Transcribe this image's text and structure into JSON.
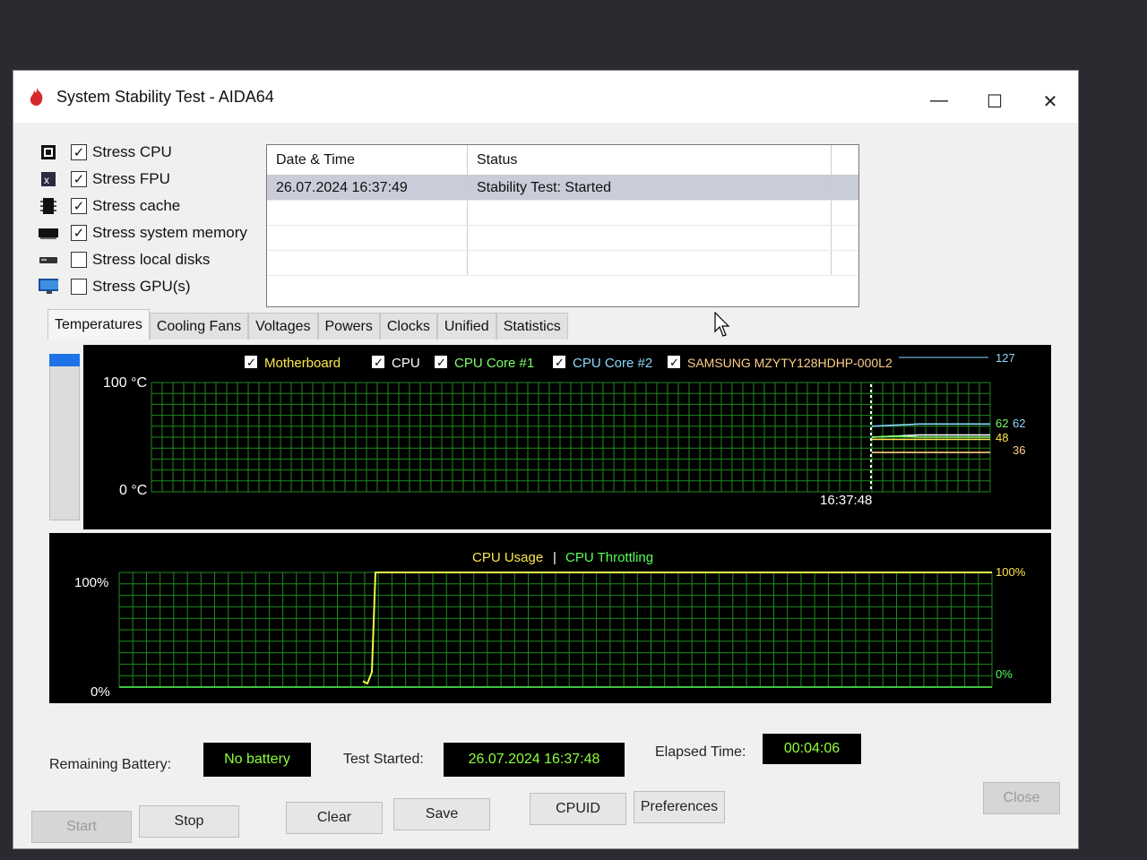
{
  "window": {
    "title": "System Stability Test - AIDA64",
    "controls": {
      "minimize": "—",
      "maximize": "☐",
      "close": "✕"
    }
  },
  "stress_options": [
    {
      "label": "Stress CPU",
      "checked": true,
      "icon": "cpu-chip-icon"
    },
    {
      "label": "Stress FPU",
      "checked": true,
      "icon": "fpu-chip-icon"
    },
    {
      "label": "Stress cache",
      "checked": true,
      "icon": "cache-chip-icon"
    },
    {
      "label": "Stress system memory",
      "checked": true,
      "icon": "memory-module-icon"
    },
    {
      "label": "Stress local disks",
      "checked": false,
      "icon": "disk-drive-icon"
    },
    {
      "label": "Stress GPU(s)",
      "checked": false,
      "icon": "monitor-icon"
    }
  ],
  "status_table": {
    "headers": [
      "Date & Time",
      "Status"
    ],
    "rows": [
      {
        "datetime": "26.07.2024 16:37:49",
        "status": "Stability Test: Started"
      }
    ]
  },
  "tabs": [
    "Temperatures",
    "Cooling Fans",
    "Voltages",
    "Powers",
    "Clocks",
    "Unified",
    "Statistics"
  ],
  "active_tab": "Temperatures",
  "temperature_chart": {
    "legend": [
      {
        "label": "Motherboard",
        "checked": true,
        "color": "#ffe74d"
      },
      {
        "label": "CPU",
        "checked": true,
        "color": "#ffffff"
      },
      {
        "label": "CPU Core #1",
        "checked": true,
        "color": "#7dff6a"
      },
      {
        "label": "CPU Core #2",
        "checked": true,
        "color": "#8cd7ff"
      },
      {
        "label": "SAMSUNG MZYTY128HDHP-000L2",
        "checked": true,
        "color": "#ffcf8a"
      }
    ],
    "y_top_label": "100 °C",
    "y_bottom_label": "0 °C",
    "time_label": "16:37:48",
    "right_values": [
      "127",
      "62",
      "62",
      "48",
      "36"
    ]
  },
  "cpu_chart": {
    "title_usage": "CPU Usage",
    "separator": "|",
    "title_throttling": "CPU Throttling",
    "y_top_label": "100%",
    "y_bottom_label": "0%",
    "right_top": "100%",
    "right_bottom": "0%"
  },
  "chart_data": [
    {
      "type": "line",
      "title": "",
      "ylim": [
        0,
        100
      ],
      "series": [
        {
          "name": "CPU Core #2",
          "values": [
            60,
            61,
            62,
            62,
            62,
            62
          ]
        },
        {
          "name": "CPU",
          "values": [
            50,
            51,
            52,
            52,
            52,
            52
          ]
        },
        {
          "name": "CPU Core #1",
          "values": [
            50,
            51,
            50,
            50,
            50,
            50
          ]
        },
        {
          "name": "Motherboard",
          "values": [
            48,
            48,
            48,
            48,
            48,
            48
          ]
        },
        {
          "name": "SAMSUNG MZYTY128HDHP-000L2",
          "values": [
            36,
            36,
            36,
            36,
            36,
            36
          ]
        }
      ]
    },
    {
      "type": "line",
      "title": "CPU Usage | CPU Throttling",
      "ylim": [
        0,
        100
      ],
      "series": [
        {
          "name": "CPU Usage",
          "values": [
            2,
            0,
            10,
            100,
            100,
            100,
            100,
            100,
            100,
            100,
            100,
            100
          ]
        },
        {
          "name": "CPU Throttling",
          "values": [
            0,
            0,
            0,
            0,
            0,
            0,
            0,
            0,
            0,
            0,
            0,
            0
          ]
        }
      ]
    }
  ],
  "info": {
    "battery_label": "Remaining Battery:",
    "battery_value": "No battery",
    "started_label": "Test Started:",
    "started_value": "26.07.2024 16:37:48",
    "elapsed_label": "Elapsed Time:",
    "elapsed_value": "00:04:06"
  },
  "buttons": {
    "start": "Start",
    "stop": "Stop",
    "clear": "Clear",
    "save": "Save",
    "cpuid": "CPUID",
    "preferences": "Preferences",
    "close": "Close"
  },
  "colors": {
    "grid": "#1f8a1f",
    "usage": "#e8ff4a",
    "throttle": "#58ff58",
    "value_text": "#8fff3a",
    "selection": "#c9ccd9",
    "accent_tab": "#1e73e8"
  }
}
